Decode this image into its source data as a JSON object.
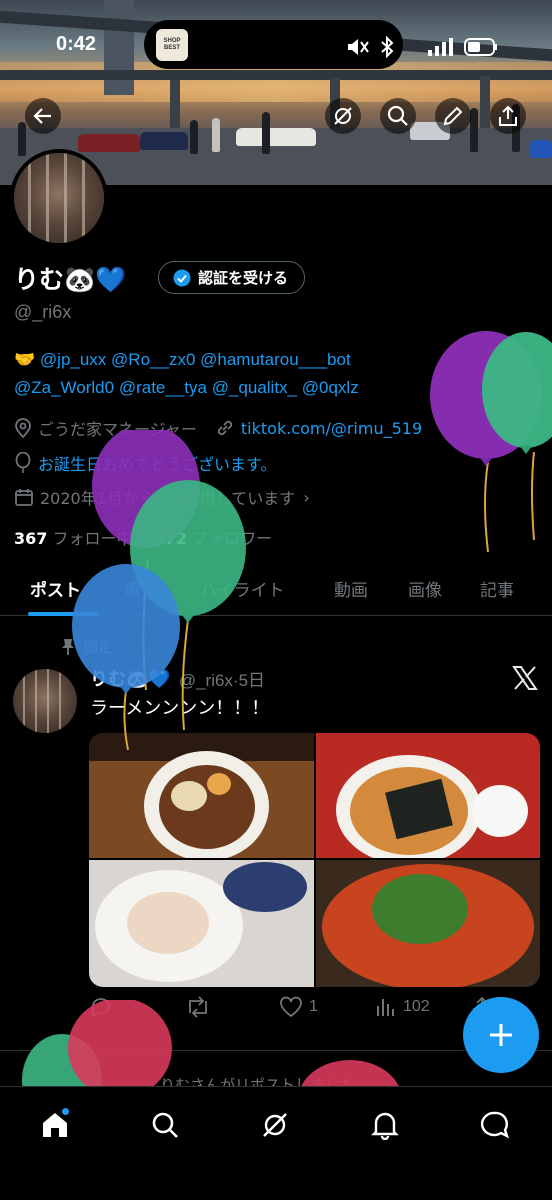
{
  "status_bar": {
    "time": "0:42",
    "island_thumb_text": "SHOP BEST"
  },
  "profile": {
    "display_name": "りむ🐼💙",
    "verify_button": "認証を受ける",
    "handle": "@_ri6x",
    "bio_emoji": "🤝",
    "bio_mentions": [
      "@jp_uxx",
      "@Ro__zx0",
      "@hamutarou___bot",
      "@Za_World0",
      "@rate__tya",
      "@_qualitx_",
      "@0qxlz"
    ],
    "location": "ごうだ家マネージャー",
    "website": "tiktok.com/@rimu_519",
    "birthday": "お誕生日おめでとうございます。",
    "joined": "2020年1月から𝕏を利用しています",
    "following_count": "367",
    "following_label": "フォロー中",
    "followers_count": "372",
    "followers_label": "フォロワー"
  },
  "tabs": [
    "ポスト",
    "返信",
    "ハイライト",
    "動画",
    "画像",
    "記事"
  ],
  "post": {
    "pinned_label": "固定",
    "author": "りむ🐼💙",
    "handle_time": "@_ri6x·5日",
    "text": "ラーメンンンン！！！",
    "likes": "1",
    "views": "102"
  },
  "repost_text": "りむさんがリポストしました",
  "colors": {
    "accent": "#1d9bf0",
    "background": "#000000",
    "muted": "#71767b"
  },
  "icons": {
    "back": "arrow-left-icon",
    "grok": "grok-icon",
    "search": "search-icon",
    "edit": "pencil-icon",
    "share": "share-icon",
    "verified": "verified-badge-icon",
    "location": "location-pin-icon",
    "link": "link-icon",
    "birthday": "balloon-icon",
    "calendar": "calendar-icon",
    "pin": "pin-icon",
    "x_logo": "x-logo-icon",
    "reply": "reply-icon",
    "retweet": "retweet-icon",
    "like": "heart-icon",
    "views": "views-icon",
    "compose": "plus-icon",
    "nav": [
      "home-icon",
      "search-icon",
      "grok-icon",
      "bell-icon",
      "messages-icon"
    ]
  }
}
